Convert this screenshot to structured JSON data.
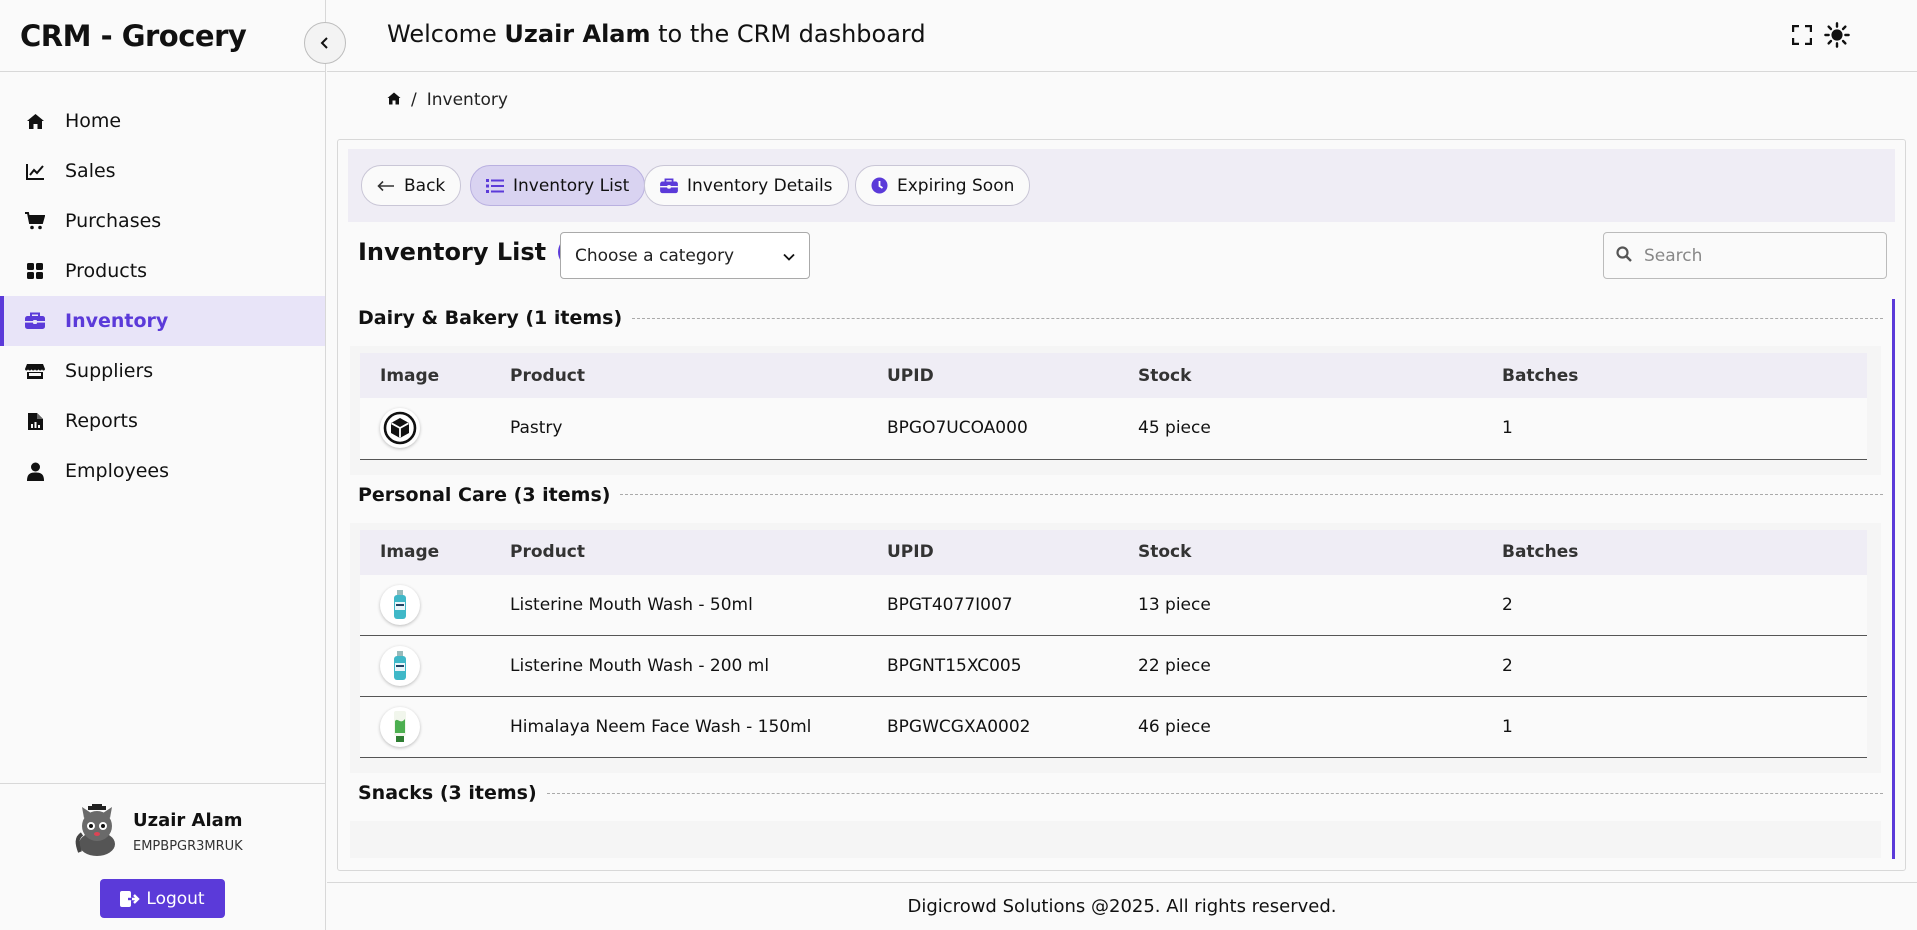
{
  "app": {
    "title": "CRM - Grocery"
  },
  "header": {
    "welcome_prefix": "Welcome",
    "user_name": "Uzair Alam",
    "welcome_suffix": "to the CRM dashboard",
    "icons": [
      "fullscreen-icon",
      "sun-icon"
    ]
  },
  "sidebar": {
    "items": [
      {
        "label": "Home",
        "icon": "home-icon"
      },
      {
        "label": "Sales",
        "icon": "chart-line-icon"
      },
      {
        "label": "Purchases",
        "icon": "cart-icon"
      },
      {
        "label": "Products",
        "icon": "grid-icon"
      },
      {
        "label": "Inventory",
        "icon": "toolbox-icon",
        "active": true
      },
      {
        "label": "Suppliers",
        "icon": "store-icon"
      },
      {
        "label": "Reports",
        "icon": "report-icon"
      },
      {
        "label": "Employees",
        "icon": "user-icon"
      }
    ]
  },
  "user": {
    "name": "Uzair Alam",
    "id": "EMPBPGR3MRUK",
    "logout_label": "Logout"
  },
  "breadcrumb": {
    "current": "Inventory"
  },
  "tabs": [
    {
      "label": "Back",
      "icon": "arrow-left-icon"
    },
    {
      "label": "Inventory List",
      "icon": "list-icon",
      "active": true
    },
    {
      "label": "Inventory Details",
      "icon": "toolbox-icon"
    },
    {
      "label": "Expiring Soon",
      "icon": "clock-icon"
    }
  ],
  "list": {
    "title": "Inventory List",
    "spinner": "( )",
    "category_placeholder": "Choose a category",
    "search_placeholder": "Search"
  },
  "columns": [
    "Image",
    "Product",
    "UPID",
    "Stock",
    "Batches"
  ],
  "groups": [
    {
      "title": "Dairy & Bakery (1 items)",
      "rows": [
        {
          "image": "box-icon",
          "product": "Pastry",
          "upid": "BPGO7UCOA000",
          "stock": "45 piece",
          "batches": "1"
        }
      ]
    },
    {
      "title": "Personal Care (3 items)",
      "rows": [
        {
          "image": "mouthwash-bottle",
          "product": "Listerine Mouth Wash - 50ml",
          "upid": "BPGT4077I007",
          "stock": "13 piece",
          "batches": "2"
        },
        {
          "image": "mouthwash-bottle",
          "product": "Listerine Mouth Wash - 200 ml",
          "upid": "BPGNT15XC005",
          "stock": "22 piece",
          "batches": "2"
        },
        {
          "image": "facewash-tube",
          "product": "Himalaya Neem Face Wash - 150ml",
          "upid": "BPGWCGXA0002",
          "stock": "46 piece",
          "batches": "1"
        }
      ]
    },
    {
      "title": "Snacks (3 items)",
      "rows": []
    }
  ],
  "footer": {
    "text": "Digicrowd Solutions @2025. All rights reserved."
  },
  "colors": {
    "accent": "#5b3ad9",
    "active_bg": "#e8e4f8",
    "tab_bar_bg": "#efedf5"
  }
}
